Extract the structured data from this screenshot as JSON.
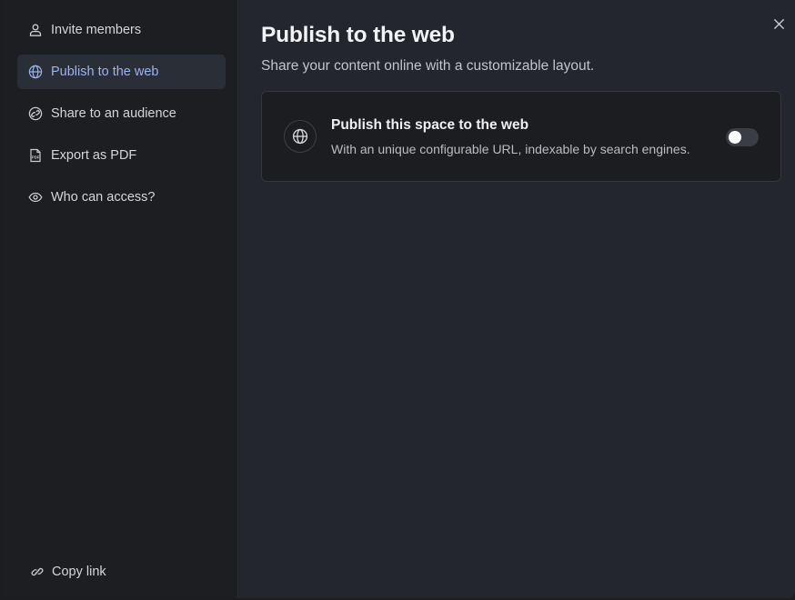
{
  "sidebar": {
    "items": [
      {
        "label": "Invite members",
        "icon": "user-icon"
      },
      {
        "label": "Publish to the web",
        "icon": "globe-icon",
        "active": true
      },
      {
        "label": "Share to an audience",
        "icon": "link-circle-icon"
      },
      {
        "label": "Export as PDF",
        "icon": "pdf-icon"
      },
      {
        "label": "Who can access?",
        "icon": "eye-icon"
      }
    ],
    "copy_link": "Copy link"
  },
  "main": {
    "title": "Publish to the web",
    "subtitle": "Share your content online with a customizable layout.",
    "card": {
      "title": "Publish this space to the web",
      "description": "With an unique configurable URL, indexable by search engines.",
      "toggle_on": false
    }
  },
  "colors": {
    "active_text": "#9bb3f0",
    "active_bg": "#2a2e36",
    "sidebar_bg": "#1c1e22",
    "main_bg": "#23262d"
  }
}
